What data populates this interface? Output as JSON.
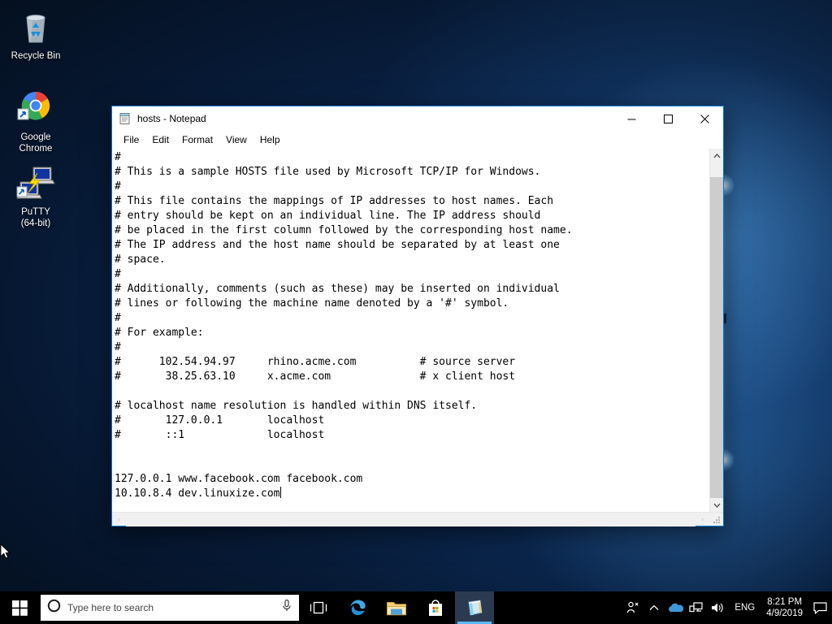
{
  "desktop": {
    "icons": [
      {
        "label": "Recycle Bin",
        "icon": "recycle-bin-icon"
      },
      {
        "label": "Google\nChrome",
        "label_line1": "Google",
        "label_line2": "Chrome",
        "icon": "google-chrome-icon"
      },
      {
        "label": "PuTTY\n(64-bit)",
        "label_line1": "PuTTY",
        "label_line2": "(64-bit)",
        "icon": "putty-icon"
      }
    ]
  },
  "window": {
    "title": "hosts - Notepad",
    "icon": "notepad-icon",
    "controls": {
      "minimize": "–",
      "maximize": "☐",
      "close": "✕"
    },
    "menu": [
      {
        "label": "File"
      },
      {
        "label": "Edit"
      },
      {
        "label": "Format"
      },
      {
        "label": "View"
      },
      {
        "label": "Help"
      }
    ],
    "content_lines": [
      "#",
      "# This is a sample HOSTS file used by Microsoft TCP/IP for Windows.",
      "#",
      "# This file contains the mappings of IP addresses to host names. Each",
      "# entry should be kept on an individual line. The IP address should",
      "# be placed in the first column followed by the corresponding host name.",
      "# The IP address and the host name should be separated by at least one",
      "# space.",
      "#",
      "# Additionally, comments (such as these) may be inserted on individual",
      "# lines or following the machine name denoted by a '#' symbol.",
      "#",
      "# For example:",
      "#",
      "#      102.54.94.97     rhino.acme.com          # source server",
      "#       38.25.63.10     x.acme.com              # x client host",
      "",
      "# localhost name resolution is handled within DNS itself.",
      "#       127.0.0.1       localhost",
      "#       ::1             localhost",
      "",
      "",
      "127.0.0.1 www.facebook.com facebook.com"
    ],
    "last_line": "10.10.8.4 dev.linuxize.com",
    "scrollbars": {
      "up_arrow": "⌃",
      "down_arrow": "⌄",
      "left_arrow": "‹",
      "right_arrow": "›"
    }
  },
  "taskbar": {
    "start": "windows-logo-icon",
    "search": {
      "placeholder": "Type here to search",
      "cortana_icon": "cortana-circle-icon",
      "mic_icon": "microphone-icon"
    },
    "apps": [
      {
        "name": "task-view-icon",
        "label": "Task View"
      },
      {
        "name": "edge-icon",
        "label": "Microsoft Edge"
      },
      {
        "name": "file-explorer-icon",
        "label": "File Explorer"
      },
      {
        "name": "microsoft-store-icon",
        "label": "Microsoft Store"
      },
      {
        "name": "notepad-taskbar-icon",
        "label": "hosts - Notepad",
        "active": true
      }
    ],
    "tray": {
      "people_icon": "people-icon",
      "chevron_icon": "show-hidden-icons-chevron",
      "onedrive_icon": "onedrive-icon",
      "network_icon": "network-icon",
      "volume_icon": "volume-icon",
      "language": "ENG",
      "time": "8:21 PM",
      "date": "4/9/2019",
      "notifications_icon": "action-center-icon"
    }
  },
  "colors": {
    "accent": "#0078d7",
    "taskbar": "#000000",
    "window_bg": "#ffffff",
    "active_underline": "#5cb8ff"
  }
}
